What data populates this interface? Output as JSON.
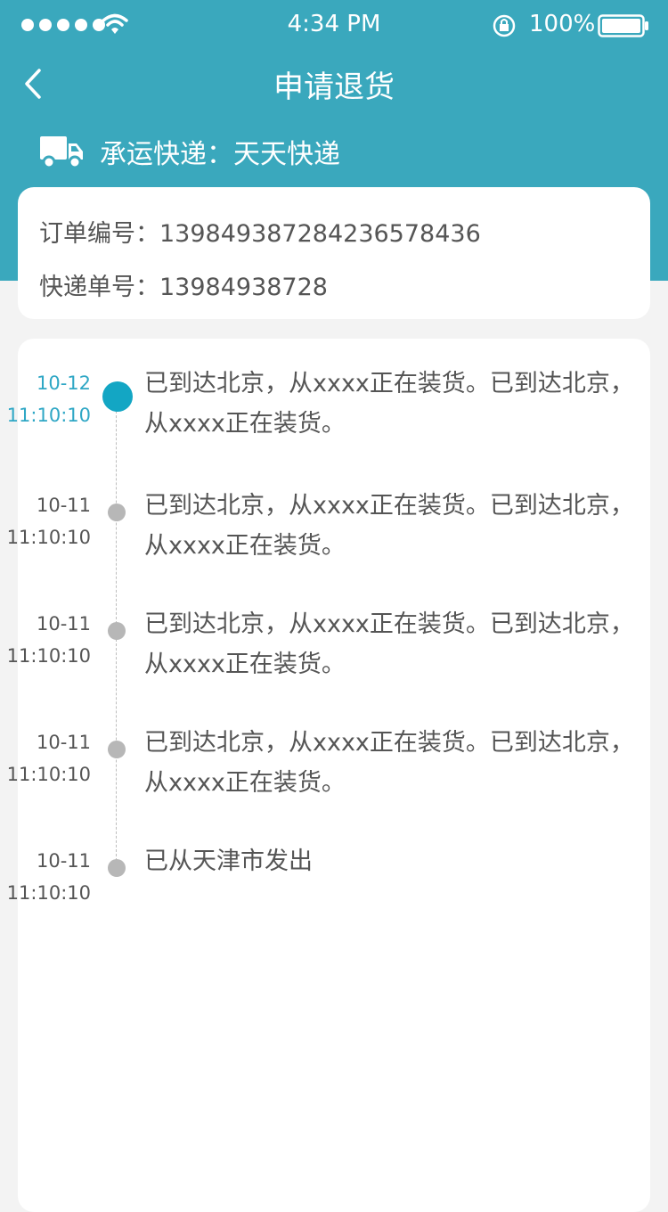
{
  "status_bar": {
    "time": "4:34 PM",
    "battery": "100%",
    "icons": [
      "signal-dots-icon",
      "wifi-icon",
      "rotation-lock-icon",
      "battery-icon"
    ]
  },
  "nav": {
    "title": "申请退货",
    "back_icon": "chevron-left-icon"
  },
  "carrier": {
    "icon": "truck-icon",
    "label": "承运快递：天天快递"
  },
  "order_info": {
    "order_no": "订单编号：1398493872842365784​36",
    "tracking_no": "快递单号：13984938728"
  },
  "timeline": [
    {
      "date": "10-12",
      "time": "11:10:10",
      "text": "已到达北京，从xxxx正在装货。已到达北京，从xxxx正在装货。",
      "active": true
    },
    {
      "date": "10-11",
      "time": "11:10:10",
      "text": "已到达北京，从xxxx正在装货。已到达北京，从xxxx正在装货。",
      "active": false
    },
    {
      "date": "10-11",
      "time": "11:10:10",
      "text": "已到达北京，从xxxx正在装货。已到达北京，从xxxx正在装货。",
      "active": false
    },
    {
      "date": "10-11",
      "time": "11:10:10",
      "text": "已到达北京，从xxxx正在装货。已到达北京，从xxxx正在装货。",
      "active": false
    },
    {
      "date": "10-11",
      "time": "11:10:10",
      "text": "已从天津市发出",
      "active": false
    }
  ],
  "colors": {
    "header": "#3aa8bd",
    "active": "#13a6c4",
    "inactive_dot": "#b7b7b7",
    "text": "#555555"
  }
}
